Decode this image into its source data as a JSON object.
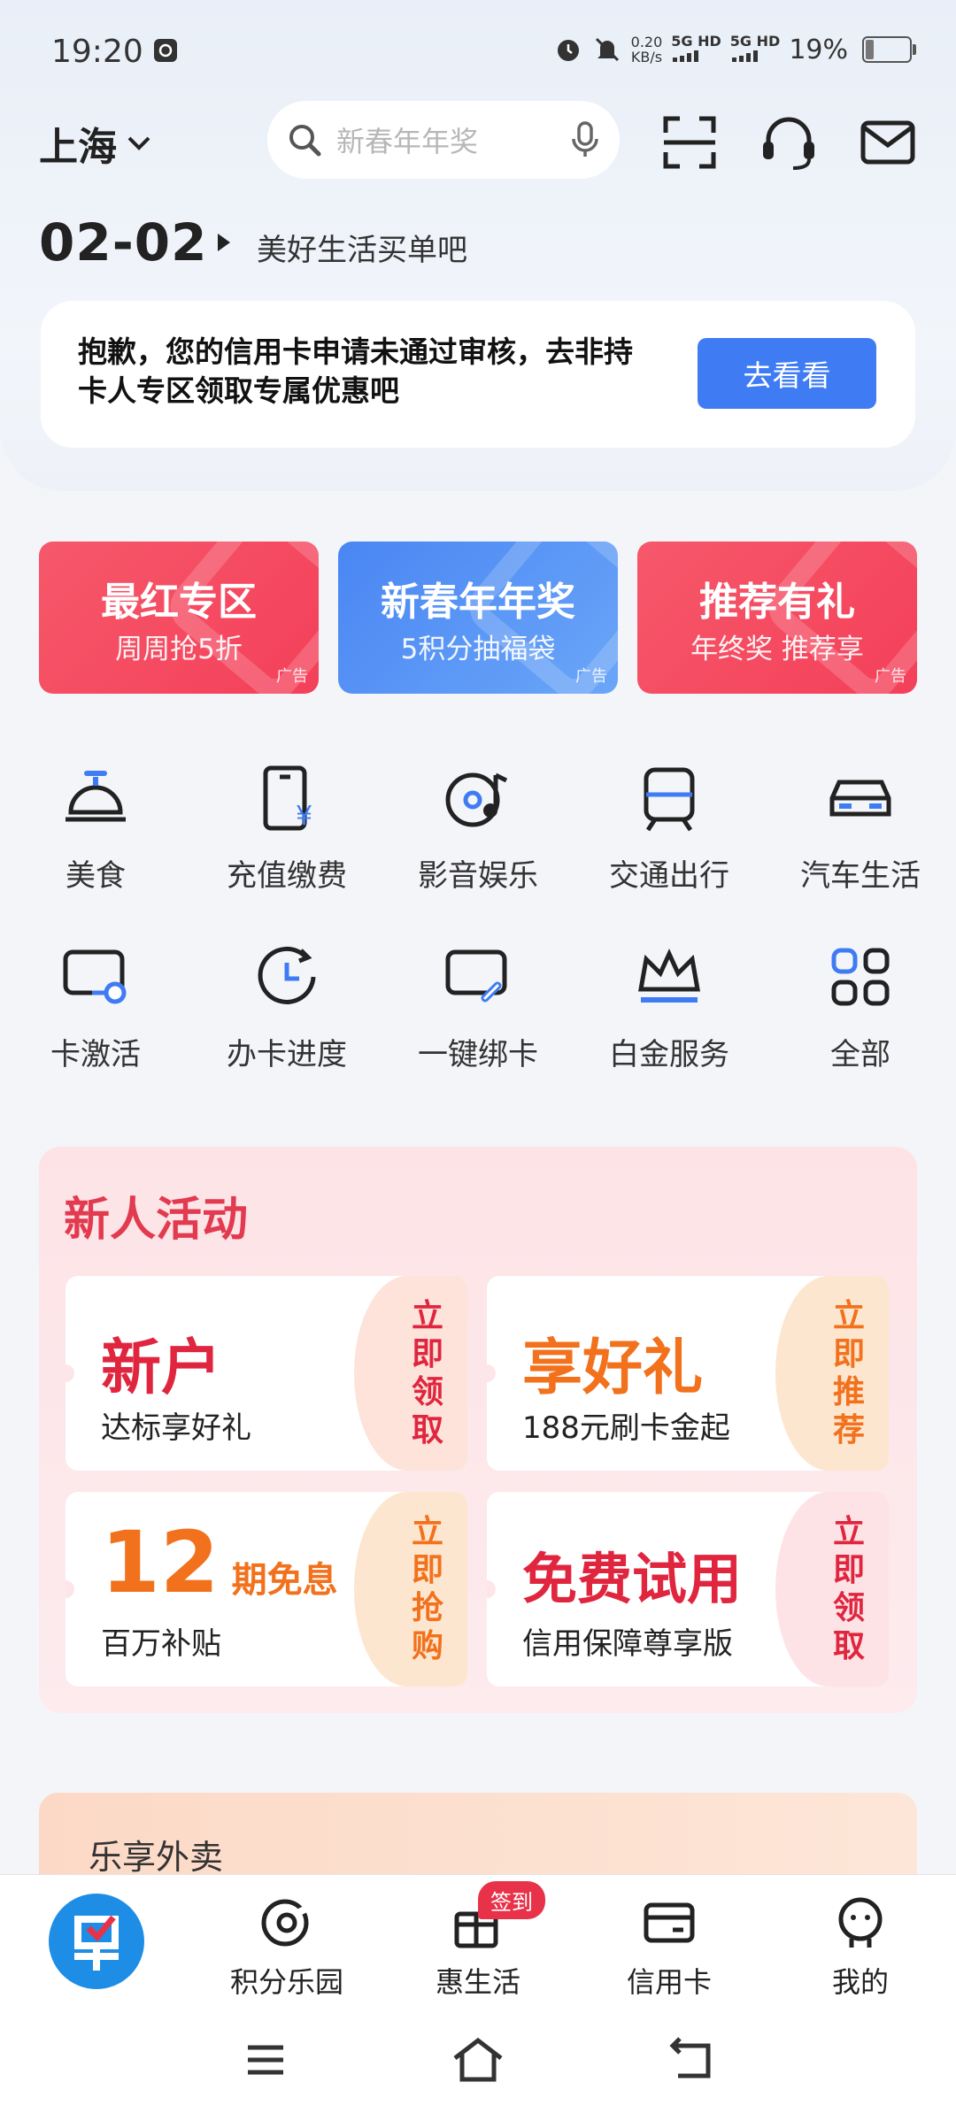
{
  "status_bar": {
    "time": "19:20",
    "net_speed": "0.20",
    "net_unit": "KB/s",
    "sim1": "5G HD",
    "sim2": "5G HD",
    "battery": "19%"
  },
  "header": {
    "city": "上海",
    "search_placeholder": "新春年年奖",
    "date": "02-02",
    "slogan": "美好生活买单吧"
  },
  "notice": {
    "text": "抱歉，您的信用卡申请未通过审核，去非持卡人专区领取专属优惠吧",
    "button": "去看看"
  },
  "promos": [
    {
      "title": "最红专区",
      "subtitle": "周周抢5折",
      "ad": "广告",
      "color": "#f5475a"
    },
    {
      "title": "新春年年奖",
      "subtitle": "5积分抽福袋",
      "ad": "广告",
      "color": "#4d8ef5"
    },
    {
      "title": "推荐有礼",
      "subtitle": "年终奖 推荐享",
      "ad": "广告",
      "color": "#f5475a"
    }
  ],
  "grid": [
    {
      "label": "美食",
      "icon": "dining-bell-icon"
    },
    {
      "label": "充值缴费",
      "icon": "phone-recharge-icon"
    },
    {
      "label": "影音娱乐",
      "icon": "music-disc-icon"
    },
    {
      "label": "交通出行",
      "icon": "train-icon"
    },
    {
      "label": "汽车生活",
      "icon": "car-icon"
    },
    {
      "label": "卡激活",
      "icon": "card-activate-icon"
    },
    {
      "label": "办卡进度",
      "icon": "progress-clock-icon"
    },
    {
      "label": "一键绑卡",
      "icon": "card-link-icon"
    },
    {
      "label": "白金服务",
      "icon": "crown-icon"
    },
    {
      "label": "全部",
      "icon": "all-grid-icon"
    }
  ],
  "new_user": {
    "title": "新人活动",
    "coupons": [
      {
        "big": "新户",
        "sub": "达标享好礼",
        "side": "立即领取",
        "color": "#e0263f",
        "side_bg": "#fde3d9"
      },
      {
        "big": "享好礼",
        "sub": "188元刷卡金起",
        "side": "立即推荐",
        "color": "#f2711c",
        "side_bg": "#fde6cf"
      },
      {
        "big": "12",
        "big_suffix": "期免息",
        "sub": "百万补贴",
        "side": "立即抢购",
        "color": "#f2711c",
        "side_bg": "#fde6cf"
      },
      {
        "big": "免费试用",
        "sub": "信用保障尊享版",
        "side": "立即领取",
        "color": "#e0263f",
        "side_bg": "#fde3e6"
      }
    ]
  },
  "next_section": {
    "title": "乐享外卖"
  },
  "tabbar": {
    "items": [
      {
        "label": "",
        "icon": "home-logo-icon"
      },
      {
        "label": "积分乐园",
        "icon": "points-icon"
      },
      {
        "label": "惠生活",
        "icon": "gift-box-icon"
      },
      {
        "label": "信用卡",
        "icon": "card-icon"
      },
      {
        "label": "我的",
        "icon": "profile-icon"
      }
    ],
    "badge": "签到"
  }
}
